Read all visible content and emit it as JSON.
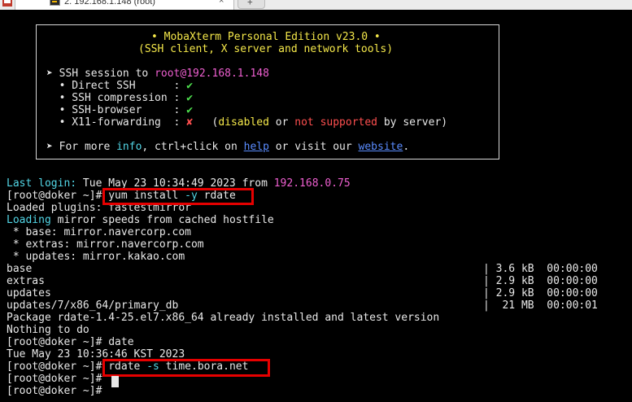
{
  "tabbar": {
    "tab_title": "2. 192.168.1.148 (root)",
    "close_glyph": "×",
    "newtab_glyph": "+"
  },
  "banner": {
    "title": "• MobaXterm Personal Edition v23.0 •",
    "subtitle": "(SSH client, X server and network tools)",
    "session_prefix": "➤ SSH session to ",
    "session_target": "root@192.168.1.148",
    "features": [
      {
        "label": "  • Direct SSH      : ",
        "mark": "✔"
      },
      {
        "label": "  • SSH compression : ",
        "mark": "✔"
      },
      {
        "label": "  • SSH-browser     : ",
        "mark": "✔"
      },
      {
        "label": "  • X11-forwarding  : ",
        "mark": "✘"
      }
    ],
    "x11_open": "   (",
    "x11_disabled": "disabled",
    "x11_or": " or ",
    "x11_not_supported": "not supported",
    "x11_tail": " by server)",
    "more_prefix": "➤ For more ",
    "more_info": "info",
    "more_mid": ", ctrl+click on ",
    "more_help": "help",
    "more_mid2": " or visit our ",
    "more_website": "website",
    "more_end": "."
  },
  "terminal": {
    "last_login_label": "Last login:",
    "last_login_text": " Tue May 23 10:34:49 2023 from ",
    "last_login_ip": "192.168.0.75",
    "prompt": "[root@doker ~]#",
    "cmd1_a": " yum install ",
    "cmd1_flag": "-y",
    "cmd1_b": " rdate",
    "loaded_plugins": "Loaded plugins: fastestmirror",
    "loading_label": "Loading",
    "loading_text": " mirror speeds from cached hostfile",
    "mirror_base": " * base: mirror.navercorp.com",
    "mirror_extras": " * extras: mirror.navercorp.com",
    "mirror_updates": " * updates: mirror.kakao.com",
    "repos": [
      {
        "name": "base",
        "size": "| 3.6 kB  00:00:00"
      },
      {
        "name": "extras",
        "size": "| 2.9 kB  00:00:00"
      },
      {
        "name": "updates",
        "size": "| 2.9 kB  00:00:00"
      },
      {
        "name": "updates/7/x86_64/primary_db",
        "size": "|  21 MB  00:00:01"
      }
    ],
    "package_msg": "Package rdate-1.4-25.el7.x86_64 already installed and latest version",
    "nothing": "Nothing to do",
    "cmd2": " date",
    "date_out": "Tue May 23 10:36:46 KST 2023",
    "cmd3_a": " rdate ",
    "cmd3_flag": "-s",
    "cmd3_b": " time.bora.net"
  },
  "colors": {
    "highlight_box": "#e60000",
    "yellow": "#f5e84a",
    "cyan": "#52d6e6",
    "magenta": "#ee5fd0",
    "green": "#4ee04e",
    "red": "#ff4f4f"
  }
}
